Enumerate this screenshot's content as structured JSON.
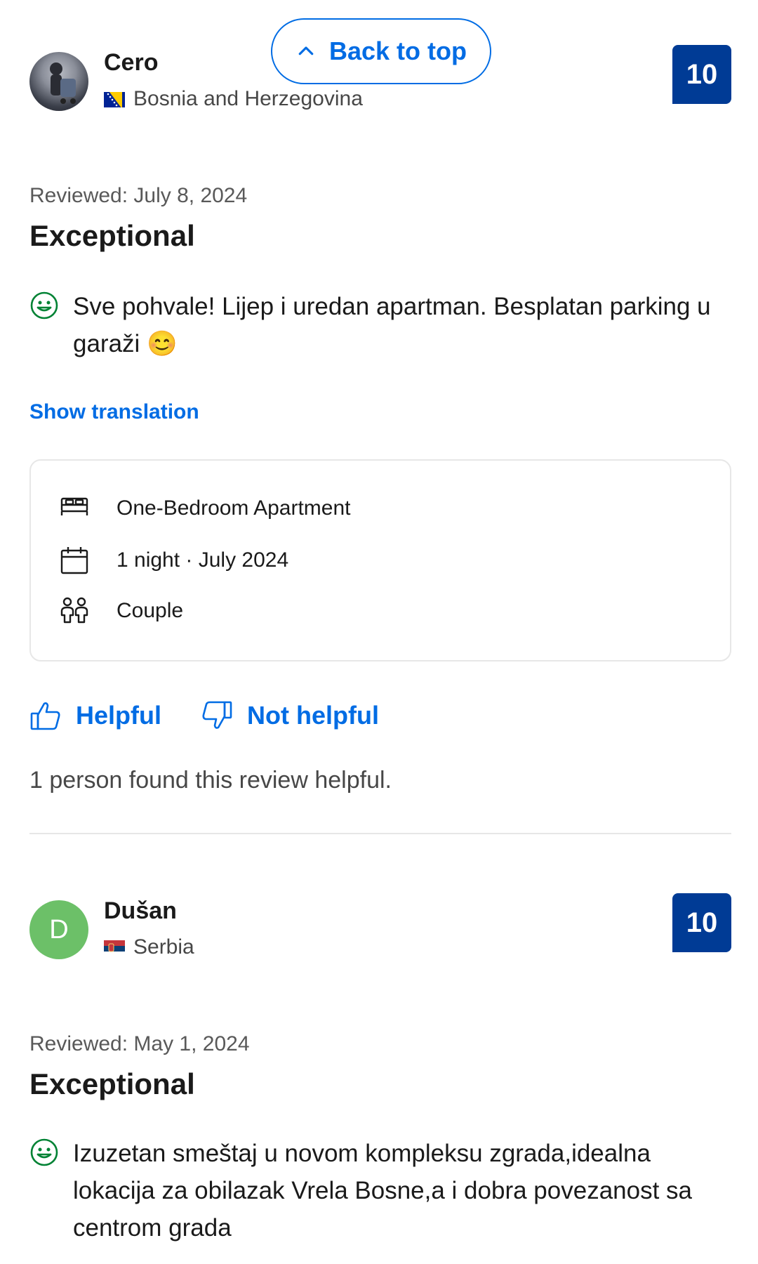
{
  "back_to_top": {
    "label": "Back to top"
  },
  "reviews": [
    {
      "name": "Cero",
      "country": "Bosnia and Herzegovina",
      "score": "10",
      "date": "Reviewed: July 8, 2024",
      "title": "Exceptional",
      "text": "Sve pohvale! Lijep i uredan apartman. Besplatan parking u garaži 😊",
      "translation_link": "Show translation",
      "room": "One-Bedroom Apartment",
      "stay": "1 night · July 2024",
      "traveler_type": "Couple",
      "helpful_label": "Helpful",
      "not_helpful_label": "Not helpful",
      "helpful_count": "1 person found this review helpful."
    },
    {
      "name": "Dušan",
      "initial": "D",
      "country": "Serbia",
      "score": "10",
      "date": "Reviewed: May 1, 2024",
      "title": "Exceptional",
      "text": "Izuzetan smeštaj u novom kompleksu zgrada,idealna lokacija za obilazak Vrela Bosne,a i dobra povezanost sa centrom grada"
    }
  ],
  "colors": {
    "brand_blue": "#003b95",
    "link_blue": "#006ce4",
    "positive_green": "#008234"
  },
  "icons": [
    "chevron-up-icon",
    "smile-icon",
    "bed-icon",
    "calendar-icon",
    "people-icon",
    "thumbs-up-icon",
    "thumbs-down-icon"
  ]
}
